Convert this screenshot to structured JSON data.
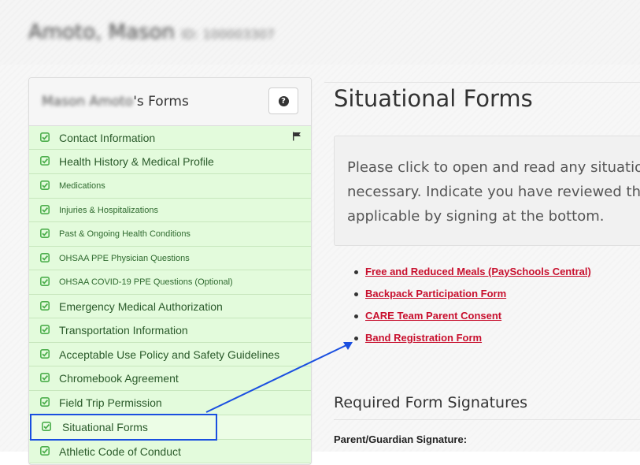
{
  "header": {
    "student_name": "Amoto, Mason",
    "student_id": "ID: 100003307"
  },
  "sidebar": {
    "title_name": "Mason Amoto",
    "title_suffix": "'s Forms",
    "help_label": "?",
    "items": [
      {
        "label": "Contact Information",
        "sub": false,
        "flag": true
      },
      {
        "label": "Health History & Medical Profile",
        "sub": false
      },
      {
        "label": "Medications",
        "sub": true
      },
      {
        "label": "Injuries & Hospitalizations",
        "sub": true
      },
      {
        "label": "Past & Ongoing Health Conditions",
        "sub": true
      },
      {
        "label": "OHSAA PPE Physician Questions",
        "sub": true
      },
      {
        "label": "OHSAA COVID-19 PPE Questions (Optional)",
        "sub": true
      },
      {
        "label": "Emergency Medical Authorization",
        "sub": false
      },
      {
        "label": "Transportation Information",
        "sub": false
      },
      {
        "label": "Acceptable Use Policy and Safety Guidelines",
        "sub": false
      },
      {
        "label": "Chromebook Agreement",
        "sub": false
      },
      {
        "label": "Field Trip Permission",
        "sub": false
      },
      {
        "label": "Situational Forms",
        "sub": false,
        "active": true
      },
      {
        "label": "Athletic Code of Conduct",
        "sub": false
      }
    ]
  },
  "main": {
    "title": "Situational Forms",
    "instructions": [
      "Please click to open and read any situation",
      "necessary. Indicate you have reviewed the",
      "applicable by signing at the bottom."
    ],
    "links": [
      "Free and Reduced Meals (PaySchools Central)",
      "Backpack Participation Form",
      "CARE Team Parent Consent",
      "Band Registration Form"
    ],
    "signatures_heading": "Required Form Signatures",
    "parent_signature_label": "Parent/Guardian Signature:"
  },
  "colors": {
    "item_bg": "#e3fbdc",
    "item_text": "#2a5a2a",
    "check": "#4cae4c",
    "link": "#c8102e",
    "annotation": "#1a4fe0"
  },
  "icons": {
    "check": "check-square-icon",
    "flag": "flag-icon",
    "help": "question-circle-icon"
  }
}
